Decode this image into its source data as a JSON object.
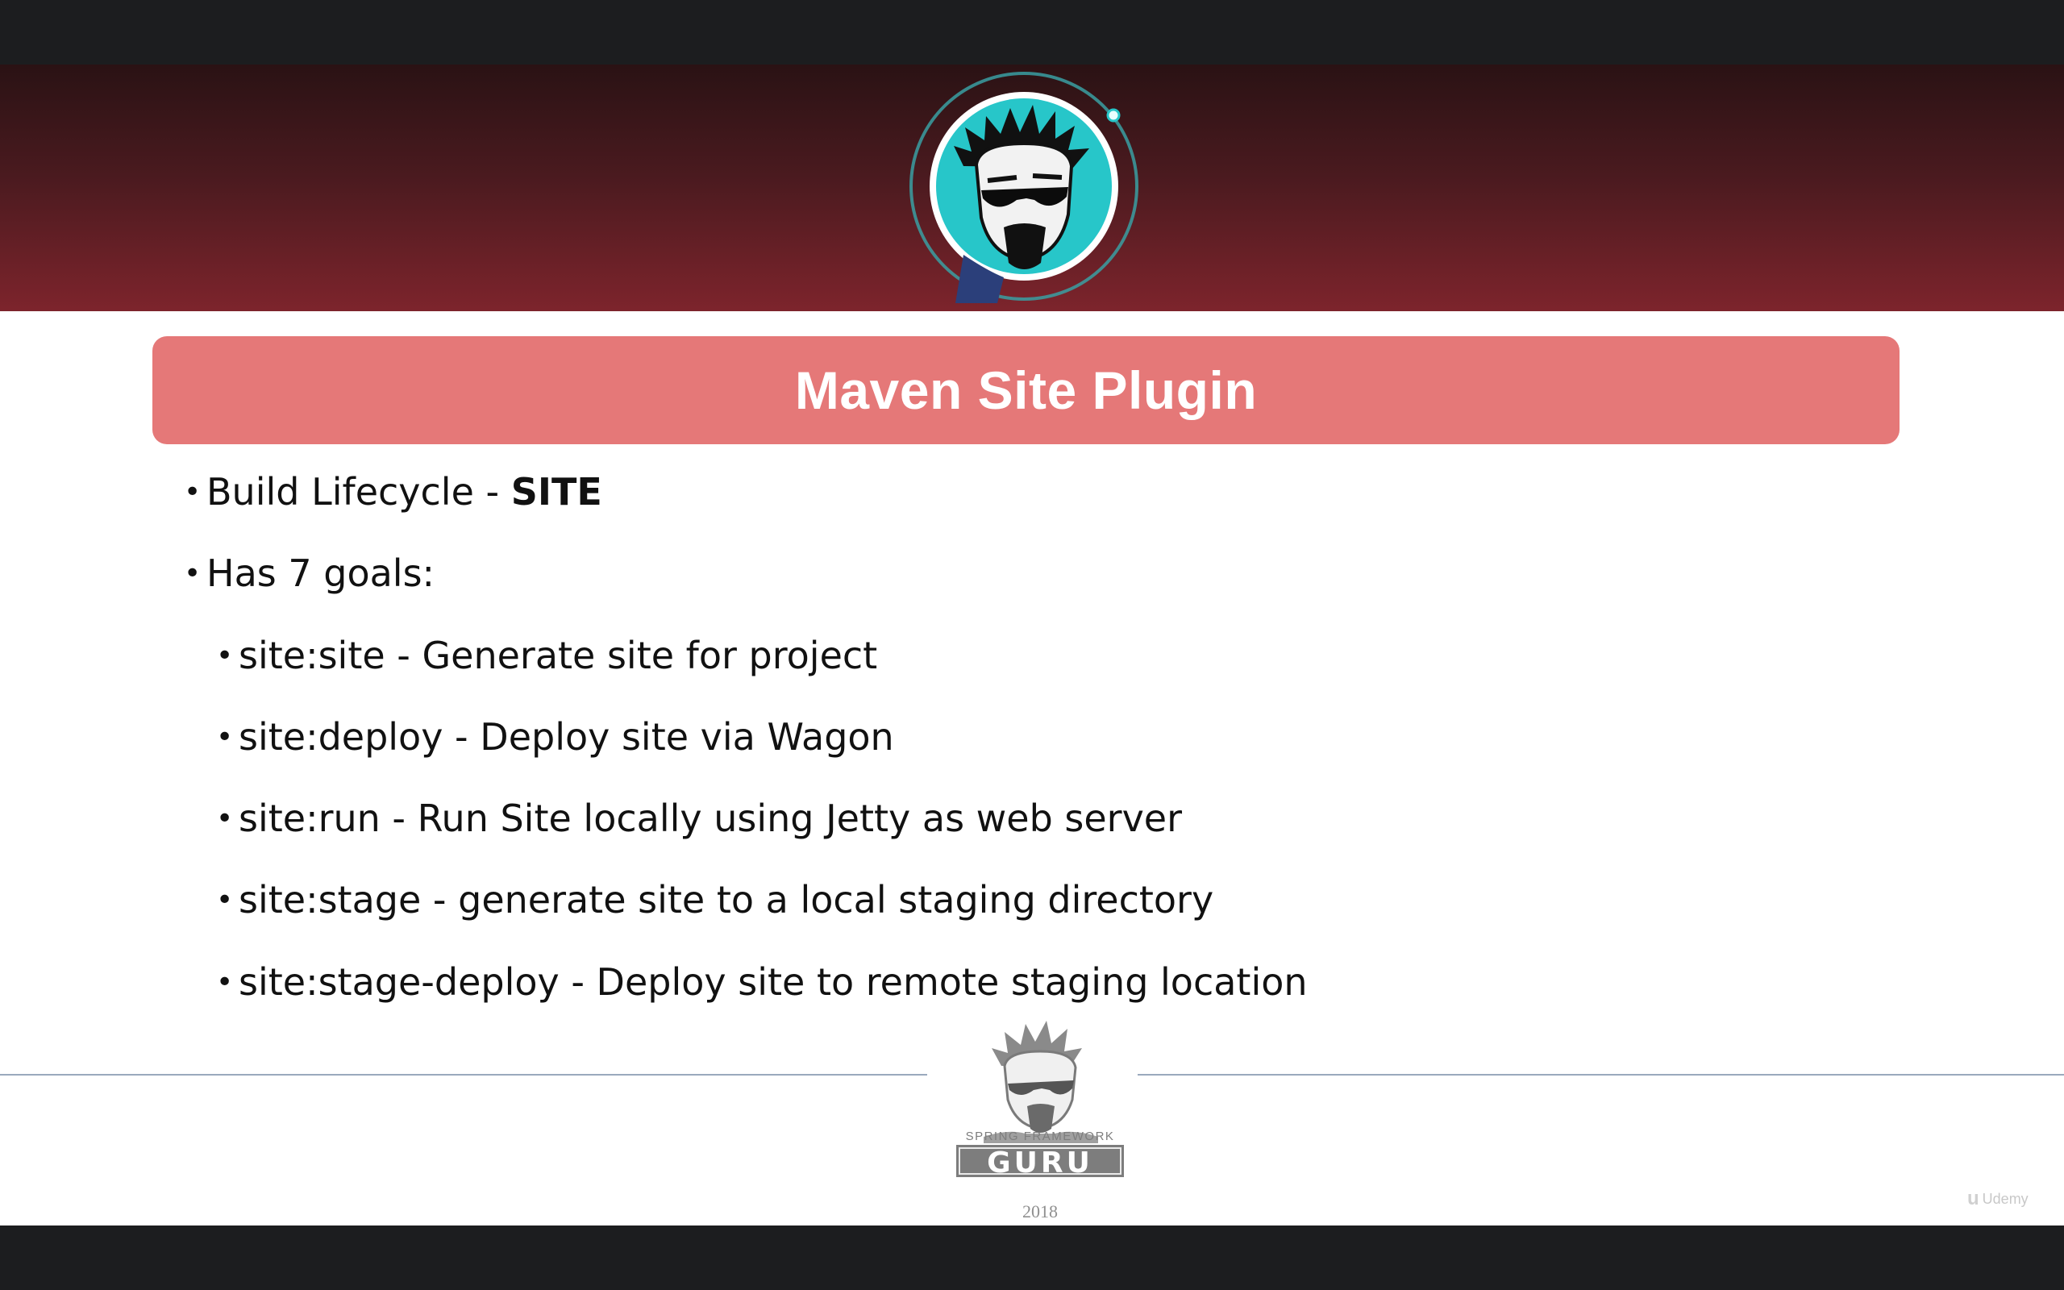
{
  "slide": {
    "title": "Maven Site Plugin",
    "bullets": [
      {
        "level": 1,
        "text": "Build Lifecycle - ",
        "bold": "SITE"
      },
      {
        "level": 1,
        "text": "Has 7 goals:"
      },
      {
        "level": 2,
        "text": "site:site - Generate site for project"
      },
      {
        "level": 2,
        "text": "site:deploy - Deploy site via Wagon"
      },
      {
        "level": 2,
        "text": "site:run - Run Site locally using Jetty as web server"
      },
      {
        "level": 2,
        "text": "site:stage - generate site to a local staging directory"
      },
      {
        "level": 2,
        "text": "site:stage-deploy - Deploy site to remote staging location"
      }
    ]
  },
  "footer": {
    "logo_caption": "SPRING FRAMEWORK",
    "logo_word": "GURU",
    "year": "2018"
  },
  "watermark": {
    "label": "Udemy"
  },
  "colors": {
    "banner_top": "#2a1214",
    "banner_bottom": "#7d242c",
    "title_bar": "#e57878",
    "teal": "#27c6c9",
    "rule": "#9aa9bd"
  },
  "icons": {
    "header_avatar": "guru-avatar-icon",
    "footer_logo": "spring-framework-guru-logo",
    "watermark": "udemy-logo-icon"
  }
}
